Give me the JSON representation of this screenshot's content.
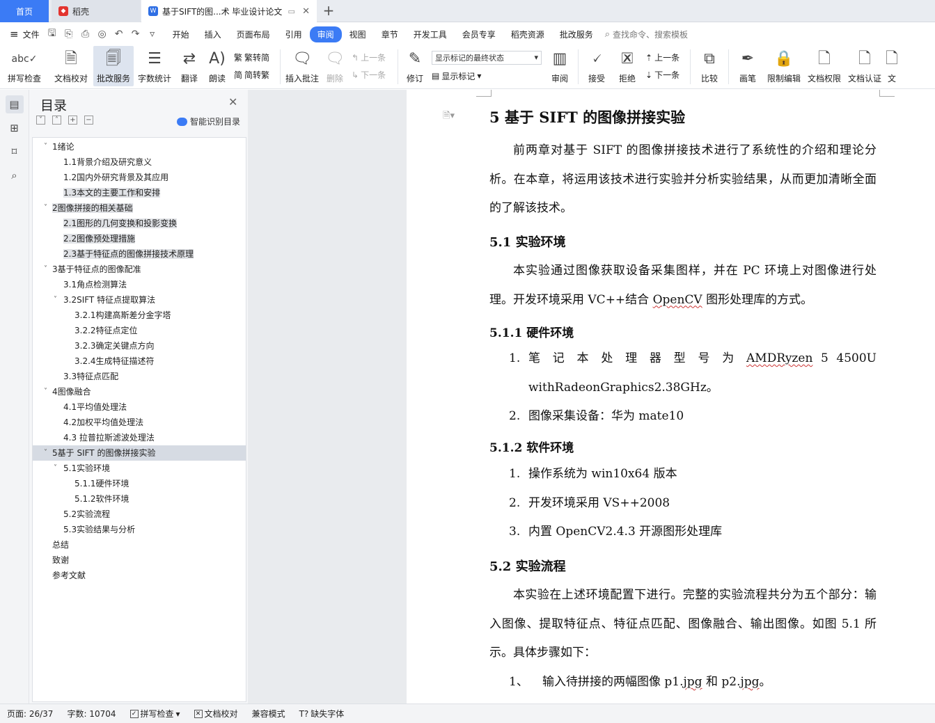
{
  "tabs": {
    "home": "首页",
    "daoke": "稻壳",
    "doc": "基于SIFT的图...术 毕业设计论文",
    "new_tab_symbol": "+"
  },
  "menu": {
    "file": "文件",
    "items": [
      "开始",
      "插入",
      "页面布局",
      "引用",
      "审阅",
      "视图",
      "章节",
      "开发工具",
      "会员专享",
      "稻壳资源",
      "批改服务"
    ],
    "active": "审阅",
    "search": "查找命令、搜索模板"
  },
  "ribbon": {
    "spell": "拼写检查",
    "proof": "文档校对",
    "review_service": "批改服务",
    "word_count": "字数统计",
    "translate": "翻译",
    "read_aloud": "朗读",
    "to_trad": "繁转简",
    "to_simp": "简转繁",
    "insert_comment": "插入批注",
    "delete": "删除",
    "prev": "上一条",
    "next": "下一条",
    "track": "修订",
    "markup_state": "显示标记的最终状态",
    "show_markup": "显示标记",
    "review": "审阅",
    "accept": "接受",
    "reject": "拒绝",
    "prev2": "上一条",
    "next2": "下一条",
    "compare": "比较",
    "ink": "画笔",
    "restrict": "限制编辑",
    "doc_perm": "文档权限",
    "doc_cert": "文档认证",
    "doc_more": "文"
  },
  "toc": {
    "title": "目录",
    "smart": "智能识别目录",
    "items": [
      {
        "text": "1绪论",
        "level": 1,
        "expand": true
      },
      {
        "text": "1.1背景介绍及研究意义",
        "level": 2
      },
      {
        "text": "1.2国内外研究背景及其应用",
        "level": 2
      },
      {
        "text": "1.3本文的主要工作和安排",
        "level": 2,
        "hl": true
      },
      {
        "text": "2图像拼接的相关基础",
        "level": 1,
        "expand": true,
        "hl": true
      },
      {
        "text": "2.1图形的几何变换和投影变换",
        "level": 2,
        "hl": true
      },
      {
        "text": "2.2图像预处理措施",
        "level": 2,
        "hl": true
      },
      {
        "text": "2.3基于特征点的图像拼接技术原理",
        "level": 2,
        "hl": true
      },
      {
        "text": "3基于特征点的图像配准",
        "level": 1,
        "expand": true
      },
      {
        "text": "3.1角点检测算法",
        "level": 2
      },
      {
        "text": "3.2SIFT 特征点提取算法",
        "level": 2,
        "expand": true
      },
      {
        "text": "3.2.1构建高斯差分金字塔",
        "level": 3
      },
      {
        "text": "3.2.2特征点定位",
        "level": 3
      },
      {
        "text": "3.2.3确定关键点方向",
        "level": 3
      },
      {
        "text": "3.2.4生成特征描述符",
        "level": 3
      },
      {
        "text": "3.3特征点匹配",
        "level": 2
      },
      {
        "text": "4图像融合",
        "level": 1,
        "expand": true
      },
      {
        "text": "4.1平均值处理法",
        "level": 2
      },
      {
        "text": "4.2加权平均值处理法",
        "level": 2
      },
      {
        "text": "4.3  拉普拉斯滤波处理法",
        "level": 2
      },
      {
        "text": "5基于 SIFT 的图像拼接实验",
        "level": 1,
        "expand": true,
        "selected": true
      },
      {
        "text": "5.1实验环境",
        "level": 2,
        "expand": true
      },
      {
        "text": "5.1.1硬件环境",
        "level": 3
      },
      {
        "text": "5.1.2软件环境",
        "level": 3
      },
      {
        "text": "5.2实验流程",
        "level": 2
      },
      {
        "text": "5.3实验结果与分析",
        "level": 2
      },
      {
        "text": "总结",
        "level": 1
      },
      {
        "text": "致谢",
        "level": 1
      },
      {
        "text": "参考文献",
        "level": 1
      }
    ]
  },
  "doc": {
    "h1": "5  基于 SIFT 的图像拼接实验",
    "p1": "前两章对基于 SIFT 的图像拼接技术进行了系统性的介绍和理论分析。在本章，将运用该技术进行实验并分析实验结果，从而更加清晰全面的了解该技术。",
    "h2_1": "5.1  实验环境",
    "p2a": "本实验通过图像获取设备采集图样，并在 PC 环境上对图像进行处理。开发环境采用 VC++结合 ",
    "p2b": "OpenCV",
    "p2c": " 图形处理库的方式。",
    "h3_1": "5.1.1  硬件环境",
    "hw1_n": "1.",
    "hw1_a": "笔 记 本 处 理 器 型 号 为 ",
    "hw1_b": "AMDRyzen",
    "hw1_c": " 5 4500U withRadeonGraphics2.38GHz。",
    "hw2_n": "2.",
    "hw2": "图像采集设备：华为 mate10",
    "h3_2": "5.1.2  软件环境",
    "sw1_n": "1.",
    "sw1": "操作系统为 win10x64 版本",
    "sw2_n": "2.",
    "sw2": "开发环境采用 VS++2008",
    "sw3_n": "3.",
    "sw3": "内置 OpenCV2.4.3 开源图形处理库",
    "h2_2": "5.2  实验流程",
    "p3": "本实验在上述环境配置下进行。完整的实验流程共分为五个部分：输入图像、提取特征点、特征点匹配、图像融合、输出图像。如图 5.1 所示。具体步骤如下：",
    "st1_n": "1、",
    "st1_a": "输入待拼接的两幅图像 p1.",
    "st1_b": "jpg",
    "st1_c": " 和 p2.",
    "st1_d": "jpg",
    "st1_e": "。"
  },
  "status": {
    "page": "页面: 26/37",
    "words": "字数: 10704",
    "spell": "拼写检查",
    "proof": "文档校对",
    "compat": "兼容模式",
    "missing_font": "缺失字体"
  }
}
